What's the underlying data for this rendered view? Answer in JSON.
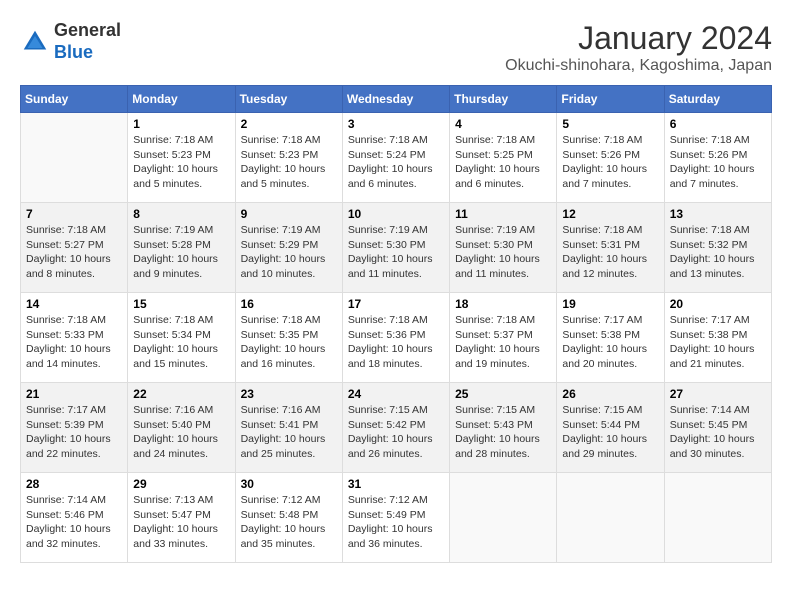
{
  "logo": {
    "general": "General",
    "blue": "Blue"
  },
  "title": "January 2024",
  "subtitle": "Okuchi-shinohara, Kagoshima, Japan",
  "headers": [
    "Sunday",
    "Monday",
    "Tuesday",
    "Wednesday",
    "Thursday",
    "Friday",
    "Saturday"
  ],
  "weeks": [
    [
      {
        "day": "",
        "info": ""
      },
      {
        "day": "1",
        "info": "Sunrise: 7:18 AM\nSunset: 5:23 PM\nDaylight: 10 hours\nand 5 minutes."
      },
      {
        "day": "2",
        "info": "Sunrise: 7:18 AM\nSunset: 5:23 PM\nDaylight: 10 hours\nand 5 minutes."
      },
      {
        "day": "3",
        "info": "Sunrise: 7:18 AM\nSunset: 5:24 PM\nDaylight: 10 hours\nand 6 minutes."
      },
      {
        "day": "4",
        "info": "Sunrise: 7:18 AM\nSunset: 5:25 PM\nDaylight: 10 hours\nand 6 minutes."
      },
      {
        "day": "5",
        "info": "Sunrise: 7:18 AM\nSunset: 5:26 PM\nDaylight: 10 hours\nand 7 minutes."
      },
      {
        "day": "6",
        "info": "Sunrise: 7:18 AM\nSunset: 5:26 PM\nDaylight: 10 hours\nand 7 minutes."
      }
    ],
    [
      {
        "day": "7",
        "info": "Sunrise: 7:18 AM\nSunset: 5:27 PM\nDaylight: 10 hours\nand 8 minutes."
      },
      {
        "day": "8",
        "info": "Sunrise: 7:19 AM\nSunset: 5:28 PM\nDaylight: 10 hours\nand 9 minutes."
      },
      {
        "day": "9",
        "info": "Sunrise: 7:19 AM\nSunset: 5:29 PM\nDaylight: 10 hours\nand 10 minutes."
      },
      {
        "day": "10",
        "info": "Sunrise: 7:19 AM\nSunset: 5:30 PM\nDaylight: 10 hours\nand 11 minutes."
      },
      {
        "day": "11",
        "info": "Sunrise: 7:19 AM\nSunset: 5:30 PM\nDaylight: 10 hours\nand 11 minutes."
      },
      {
        "day": "12",
        "info": "Sunrise: 7:18 AM\nSunset: 5:31 PM\nDaylight: 10 hours\nand 12 minutes."
      },
      {
        "day": "13",
        "info": "Sunrise: 7:18 AM\nSunset: 5:32 PM\nDaylight: 10 hours\nand 13 minutes."
      }
    ],
    [
      {
        "day": "14",
        "info": "Sunrise: 7:18 AM\nSunset: 5:33 PM\nDaylight: 10 hours\nand 14 minutes."
      },
      {
        "day": "15",
        "info": "Sunrise: 7:18 AM\nSunset: 5:34 PM\nDaylight: 10 hours\nand 15 minutes."
      },
      {
        "day": "16",
        "info": "Sunrise: 7:18 AM\nSunset: 5:35 PM\nDaylight: 10 hours\nand 16 minutes."
      },
      {
        "day": "17",
        "info": "Sunrise: 7:18 AM\nSunset: 5:36 PM\nDaylight: 10 hours\nand 18 minutes."
      },
      {
        "day": "18",
        "info": "Sunrise: 7:18 AM\nSunset: 5:37 PM\nDaylight: 10 hours\nand 19 minutes."
      },
      {
        "day": "19",
        "info": "Sunrise: 7:17 AM\nSunset: 5:38 PM\nDaylight: 10 hours\nand 20 minutes."
      },
      {
        "day": "20",
        "info": "Sunrise: 7:17 AM\nSunset: 5:38 PM\nDaylight: 10 hours\nand 21 minutes."
      }
    ],
    [
      {
        "day": "21",
        "info": "Sunrise: 7:17 AM\nSunset: 5:39 PM\nDaylight: 10 hours\nand 22 minutes."
      },
      {
        "day": "22",
        "info": "Sunrise: 7:16 AM\nSunset: 5:40 PM\nDaylight: 10 hours\nand 24 minutes."
      },
      {
        "day": "23",
        "info": "Sunrise: 7:16 AM\nSunset: 5:41 PM\nDaylight: 10 hours\nand 25 minutes."
      },
      {
        "day": "24",
        "info": "Sunrise: 7:15 AM\nSunset: 5:42 PM\nDaylight: 10 hours\nand 26 minutes."
      },
      {
        "day": "25",
        "info": "Sunrise: 7:15 AM\nSunset: 5:43 PM\nDaylight: 10 hours\nand 28 minutes."
      },
      {
        "day": "26",
        "info": "Sunrise: 7:15 AM\nSunset: 5:44 PM\nDaylight: 10 hours\nand 29 minutes."
      },
      {
        "day": "27",
        "info": "Sunrise: 7:14 AM\nSunset: 5:45 PM\nDaylight: 10 hours\nand 30 minutes."
      }
    ],
    [
      {
        "day": "28",
        "info": "Sunrise: 7:14 AM\nSunset: 5:46 PM\nDaylight: 10 hours\nand 32 minutes."
      },
      {
        "day": "29",
        "info": "Sunrise: 7:13 AM\nSunset: 5:47 PM\nDaylight: 10 hours\nand 33 minutes."
      },
      {
        "day": "30",
        "info": "Sunrise: 7:12 AM\nSunset: 5:48 PM\nDaylight: 10 hours\nand 35 minutes."
      },
      {
        "day": "31",
        "info": "Sunrise: 7:12 AM\nSunset: 5:49 PM\nDaylight: 10 hours\nand 36 minutes."
      },
      {
        "day": "",
        "info": ""
      },
      {
        "day": "",
        "info": ""
      },
      {
        "day": "",
        "info": ""
      }
    ]
  ]
}
